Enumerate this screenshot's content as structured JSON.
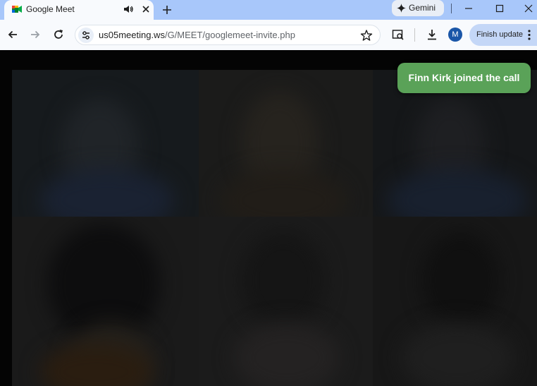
{
  "tab": {
    "title": "Google Meet",
    "favicon": "google-meet-icon",
    "audio_icon": "speaker-icon",
    "close_icon": "close-icon"
  },
  "tabstrip": {
    "new_tab_icon": "plus-icon",
    "gemini_label": "Gemini"
  },
  "toolbar": {
    "url_host": "us05meeting.ws",
    "url_path": "/G/MEET/googlemeet-invite.php",
    "avatar_letter": "M",
    "finish_update_label": "Finish update"
  },
  "notification": {
    "text": "Finn Kirk joined the call"
  },
  "colors": {
    "tabstrip": "#a8c7fa",
    "toolbar": "#f8fafd",
    "toast": "#5aa258",
    "page_background": "#040404"
  }
}
